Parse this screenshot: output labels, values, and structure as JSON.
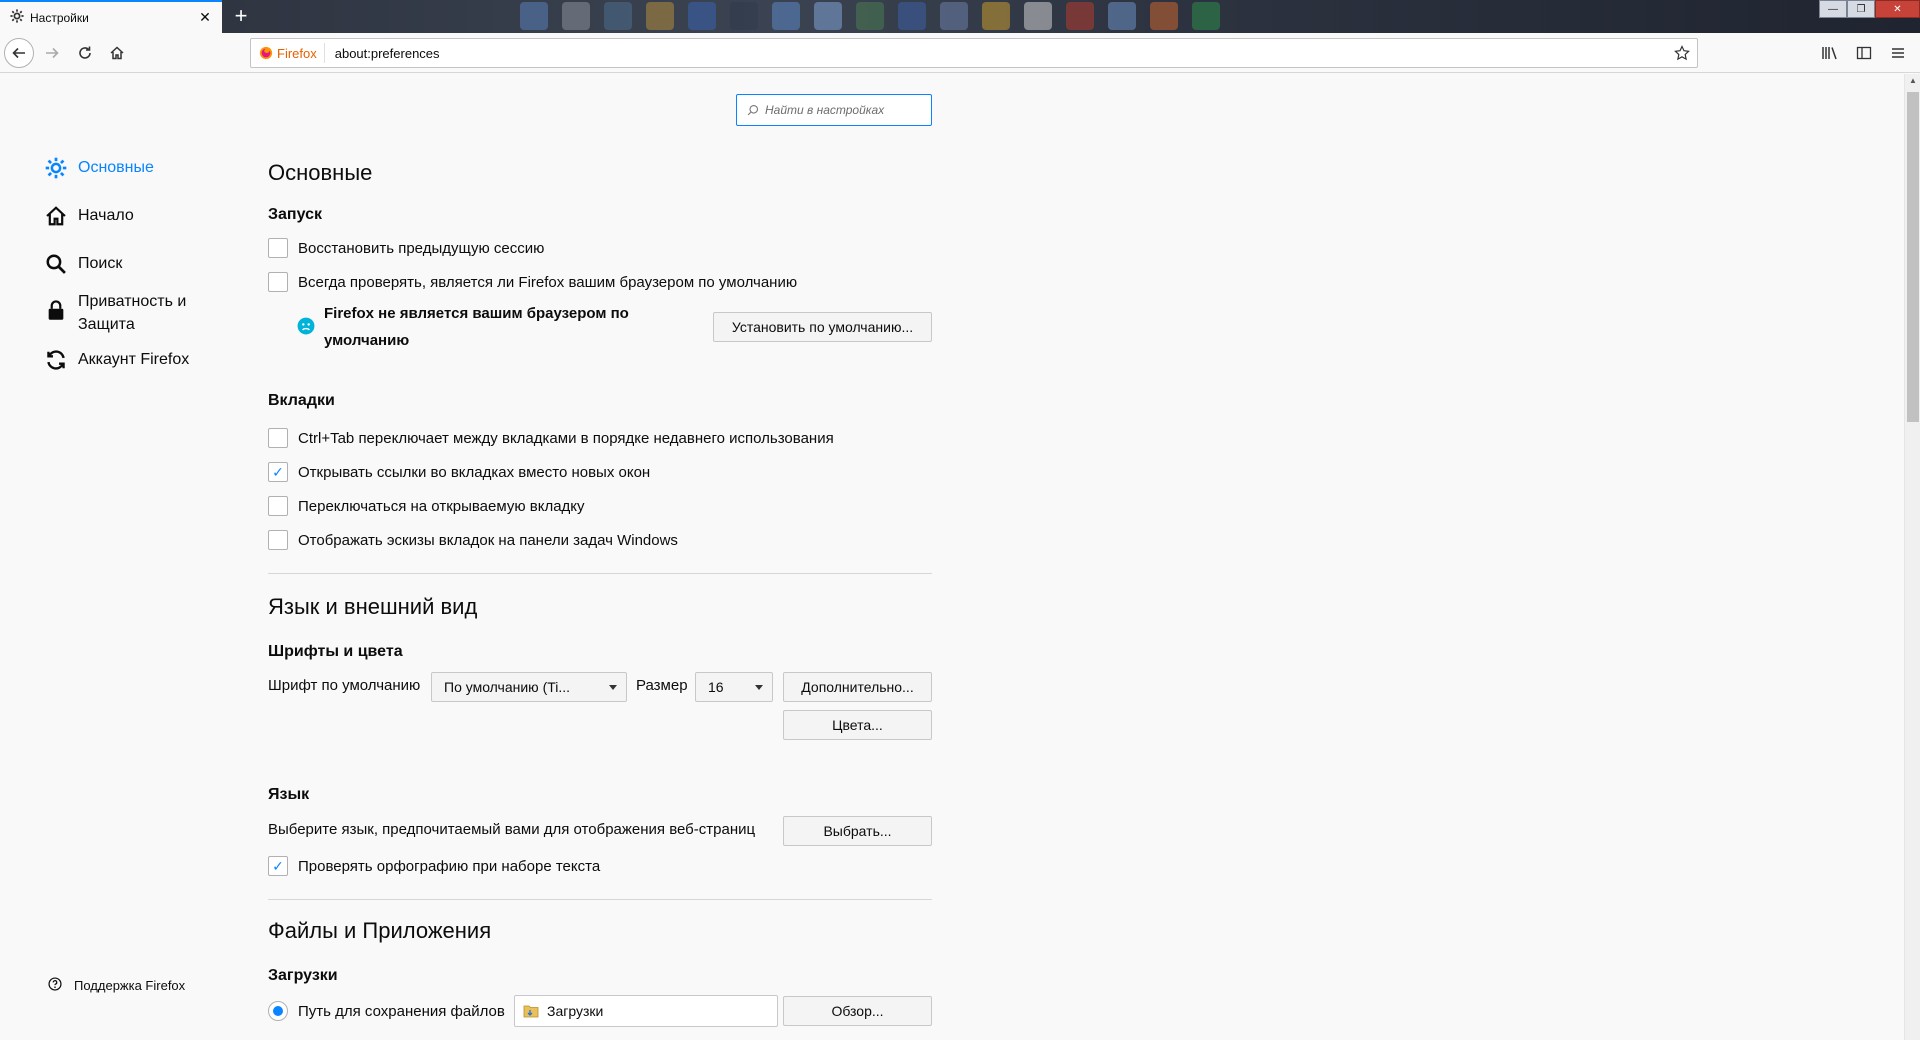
{
  "tab": {
    "title": "Настройки",
    "close": "✕",
    "new_tab": "+"
  },
  "window": {
    "minimize": "—",
    "maximize": "❐",
    "close": "✕"
  },
  "urlbar": {
    "identity_label": "Firefox",
    "url": "about:preferences"
  },
  "search": {
    "placeholder": "Найти в настройках"
  },
  "sidebar": {
    "items": [
      {
        "label": "Основные",
        "icon": "gear-icon",
        "selected": true
      },
      {
        "label": "Начало",
        "icon": "home-icon"
      },
      {
        "label": "Поиск",
        "icon": "search-icon"
      },
      {
        "label": "Приватность и Защита",
        "icon": "lock-icon"
      },
      {
        "label": "Аккаунт Firefox",
        "icon": "sync-icon"
      }
    ],
    "support": "Поддержка Firefox"
  },
  "general": {
    "title": "Основные",
    "startup": {
      "heading": "Запуск",
      "restore_session": "Восстановить предыдущую сессию",
      "check_default": "Всегда проверять, является ли Firefox вашим браузером по умолчанию",
      "not_default_warning": "Firefox не является вашим браузером по умолчанию",
      "set_default_button": "Установить по умолчанию..."
    },
    "tabs": {
      "heading": "Вкладки",
      "options": [
        {
          "label": "Ctrl+Tab переключает между вкладками в порядке недавнего использования",
          "checked": false
        },
        {
          "label": "Открывать ссылки во вкладках вместо новых окон",
          "checked": true
        },
        {
          "label": "Переключаться на открываемую вкладку",
          "checked": false
        },
        {
          "label": "Отображать эскизы вкладок на панели задач Windows",
          "checked": false
        }
      ]
    }
  },
  "appearance": {
    "title": "Язык и внешний вид",
    "fonts": {
      "heading": "Шрифты и цвета",
      "default_font_label": "Шрифт по умолчанию",
      "default_font_value": "По умолчанию (Ti...",
      "size_label": "Размер",
      "size_value": "16",
      "advanced_button": "Дополнительно...",
      "colors_button": "Цвета..."
    },
    "language": {
      "heading": "Язык",
      "choose_text": "Выберите язык, предпочитаемый вами для отображения веб-страниц",
      "choose_button": "Выбрать...",
      "spellcheck": "Проверять орфографию при наборе текста",
      "spellcheck_checked": true
    }
  },
  "files": {
    "title": "Файлы и Приложения",
    "downloads": {
      "heading": "Загрузки",
      "save_path_label": "Путь для сохранения файлов",
      "save_path_value": "Загрузки",
      "browse_button": "Обзор..."
    }
  },
  "colors": {
    "accent": "#0a84ff",
    "text": "#0c0c0d",
    "background": "#f9f9fa"
  }
}
